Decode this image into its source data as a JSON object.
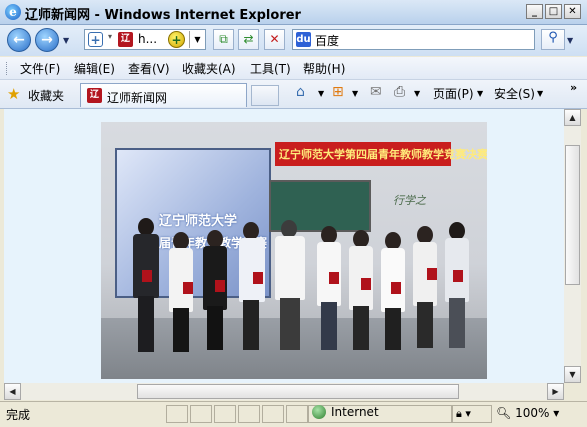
{
  "window": {
    "title": "辽师新闻网 - Windows Internet Explorer",
    "logo_glyph": "e",
    "controls": {
      "minimize": "_",
      "maximize": "□",
      "close": "✕"
    }
  },
  "navigation": {
    "back_icon": "arrow-left-icon",
    "forward_icon": "arrow-right-icon",
    "address_text": "h...",
    "site_badge": "辽",
    "search_text": "百度",
    "search_provider_glyph": "du"
  },
  "menu": {
    "items": [
      "文件(F)",
      "编辑(E)",
      "查看(V)",
      "收藏夹(A)",
      "工具(T)",
      "帮助(H)"
    ]
  },
  "favorites_bar": {
    "favorites_label": "收藏夹",
    "tab_title": "辽师新闻网",
    "commands": {
      "page": "页面(P)",
      "safety": "安全(S)"
    },
    "overflow": "»"
  },
  "photo": {
    "screen_line1": "辽宁师范大学",
    "screen_line2": "第四届青年教师教学竞赛",
    "banner": "辽宁师范大学第四届青年教师教学竞赛决赛",
    "wall_deco": "行学之"
  },
  "status_bar": {
    "status_text": "完成",
    "zone": "Internet",
    "zoom": "100%",
    "protected_mode_icon": "lock-icon"
  },
  "colors": {
    "title_bar": "#b9d1ec",
    "content_bg": "#e7f3fc",
    "banner_red": "#c91e1e",
    "site_icon_red": "#b3161f"
  }
}
